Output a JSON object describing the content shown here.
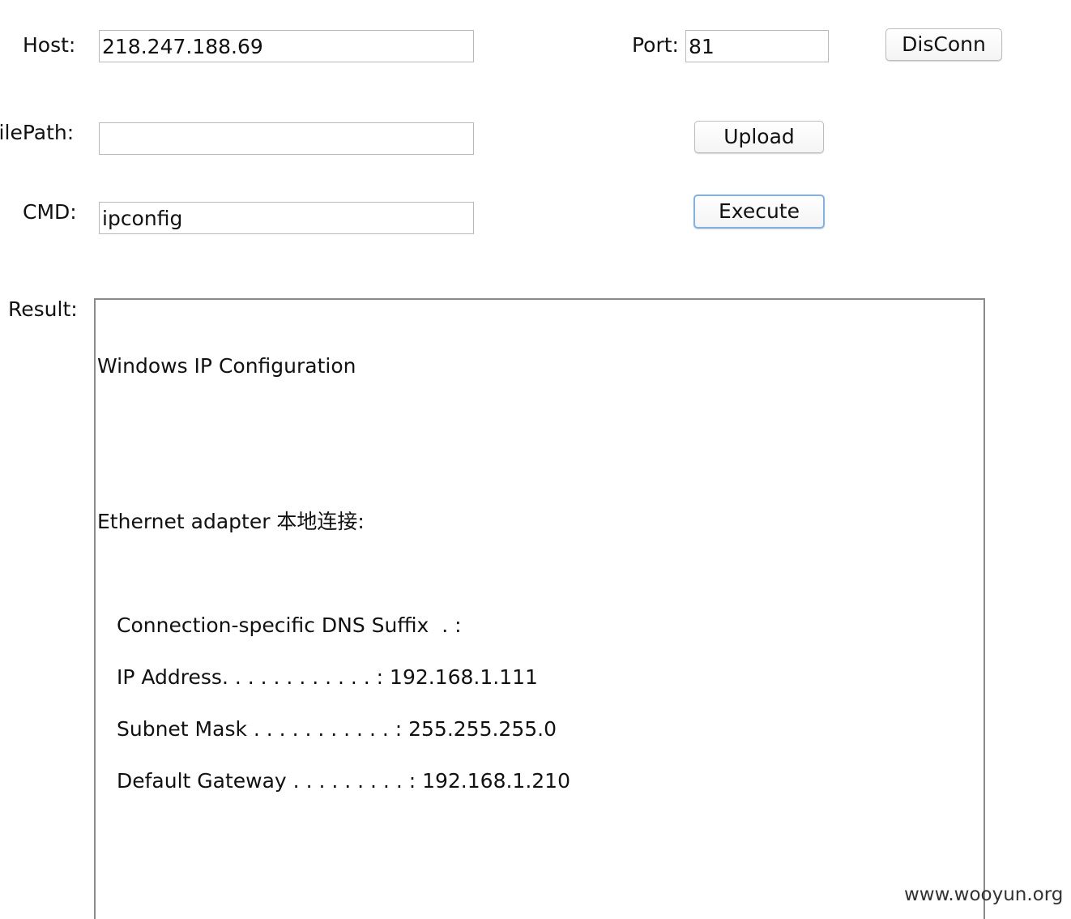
{
  "host": {
    "label": "Host:",
    "value": "218.247.188.69"
  },
  "port": {
    "label": "Port:",
    "value": "81"
  },
  "disconnect_button": "DisConn",
  "filepath": {
    "label": "FilePath:",
    "value": ""
  },
  "upload_button": "Upload",
  "cmd": {
    "label": "CMD:",
    "value": "ipconfig"
  },
  "execute_button": "Execute",
  "result": {
    "label": "Result:",
    "lines": [
      "Windows IP Configuration",
      "Ethernet adapter 本地连接:",
      "Connection-specific DNS Suffix  . :",
      "IP Address. . . . . . . . . . . . : 192.168.1.111",
      "Subnet Mask . . . . . . . . . . . : 255.255.255.0",
      "Default Gateway . . . . . . . . . : 192.168.1.210"
    ]
  },
  "watermark": "www.wooyun.org"
}
